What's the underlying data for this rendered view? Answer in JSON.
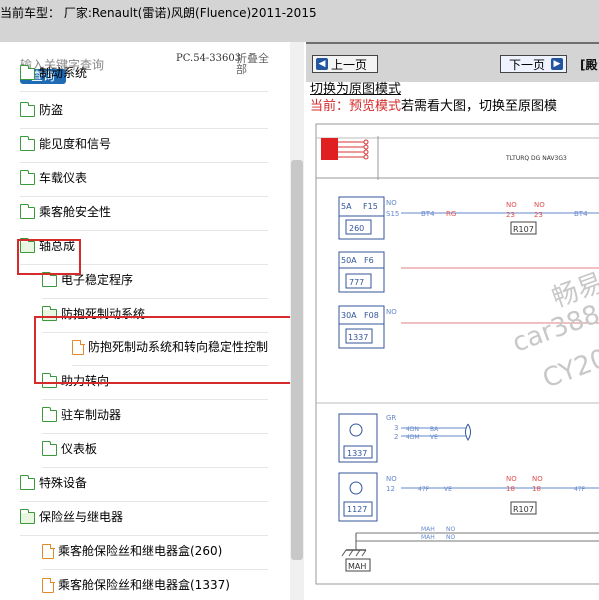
{
  "header": {
    "title": "当前车型： 厂家:Renault(雷诺)风朗(Fluence)2011-2015"
  },
  "search": {
    "placeholder": "输入关键字查询",
    "query_label": "查询",
    "pc_code": "PC.54-33603",
    "collapse_all": "折叠全部"
  },
  "tree": {
    "items": [
      {
        "label": "制动系统",
        "type": "folder"
      },
      {
        "label": "防盗",
        "type": "folder"
      },
      {
        "label": "能见度和信号",
        "type": "folder"
      },
      {
        "label": "车载仪表",
        "type": "folder"
      },
      {
        "label": "乘客舱安全性",
        "type": "folder"
      },
      {
        "label": "轴总成",
        "type": "folder-open"
      },
      {
        "label": "电子稳定程序",
        "type": "folder"
      },
      {
        "label": "防抱死制动系统",
        "type": "folder-open"
      },
      {
        "label": "防抱死制动系统和转向稳定性控制",
        "type": "doc"
      },
      {
        "label": "助力转向",
        "type": "folder"
      },
      {
        "label": "驻车制动器",
        "type": "folder"
      },
      {
        "label": "仪表板",
        "type": "folder"
      },
      {
        "label": "特殊设备",
        "type": "folder"
      },
      {
        "label": "保险丝与继电器",
        "type": "folder-open"
      },
      {
        "label": "乘客舱保险丝和继电器盒(260)",
        "type": "doc"
      },
      {
        "label": "乘客舱保险丝和继电器盒(1337)",
        "type": "doc"
      }
    ]
  },
  "viewer": {
    "prev_label": "上一页",
    "next_label": "下一页",
    "more_label": "[殿",
    "switch_link": "切换为原图模式",
    "mode_prefix": "当前：",
    "mode_name": "预览模式",
    "mode_hint": "若需看大图，切换至原图模",
    "watermark": [
      "畅易",
      "car388",
      "CY20"
    ]
  },
  "diagram": {
    "header_code": "TLTURQ DG NAV3G3",
    "fuses": [
      {
        "rating": "5A",
        "id": "F15",
        "box": "260",
        "pin1": "NO",
        "pin2": "S15"
      },
      {
        "rating": "50A",
        "id": "F6",
        "box": "777"
      },
      {
        "rating": "30A",
        "id": "F08",
        "box": "1337",
        "pin1": "NO"
      }
    ],
    "wire_labels": [
      "BT4",
      "RG",
      "NO",
      "23",
      "NO",
      "23",
      "BT4"
    ],
    "connector_1": "R107",
    "lower_1": {
      "box": "1337",
      "pins": [
        "GR",
        "3",
        "2"
      ],
      "wires": [
        "4DN",
        "BA",
        "4DM",
        "VE"
      ]
    },
    "lower_2": {
      "box": "1127",
      "pins": [
        "NO",
        "12"
      ],
      "wires": [
        "47F",
        "VE"
      ],
      "connector": "R107",
      "c_pins": [
        "NO",
        "18",
        "NO",
        "18"
      ],
      "out": "47F"
    },
    "ground_wires": [
      "MAH",
      "NO",
      "MAH",
      "NO"
    ],
    "ground_label": "MAH"
  }
}
